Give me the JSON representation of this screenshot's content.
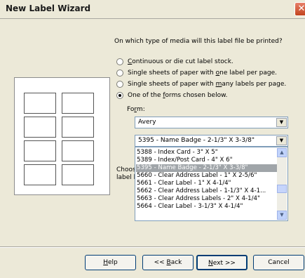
{
  "window": {
    "title": "New Label Wizard"
  },
  "question": "On which type of media will this label file be printed?",
  "options": [
    {
      "pre": "",
      "ul": "C",
      "post": "ontinuous or die cut label stock."
    },
    {
      "pre": "Single sheets of paper with ",
      "ul": "o",
      "post": "ne label per page."
    },
    {
      "pre": "Single sheets of paper with ",
      "ul": "m",
      "post": "any labels per page."
    },
    {
      "pre": "One of the ",
      "ul": "f",
      "post": "orms chosen below."
    }
  ],
  "form": {
    "label_pre": "Fo",
    "label_ul": "r",
    "label_post": "m:",
    "vendor": "Avery",
    "product": "5395 - Name Badge - 2-1/3\" X 3-3/8\""
  },
  "choose": {
    "line1": "Choos",
    "line2": "label l"
  },
  "dropdown": [
    "5388 - Index Card - 3\" X 5\"",
    "5389 - Index/Post Card - 4\" X 6\"",
    "5395 - Name Badge - 2-1/3\" X 3-3/8\"",
    "5660 - Clear Address Label - 1\" X 2-5/6\"",
    "5661 - Clear Label - 1\" X 4-1/4\"",
    "5662 - Clear Address Label - 1-1/3\" X 4-1...",
    "5663 - Clear Address Labels - 2\" X 4-1/4\"",
    "5664 - Clear Label - 3-1/3\" X 4-1/4\""
  ],
  "buttons": {
    "help": {
      "ul": "H",
      "rest": "elp"
    },
    "back": {
      "pre": "<< ",
      "ul": "B",
      "rest": "ack"
    },
    "next": {
      "ul": "N",
      "rest": "ext >>"
    },
    "cancel": "Cancel"
  },
  "colors": {
    "dialog_bg": "#ece9d8",
    "close_button": "#c2441d",
    "selection": "#a0a5a9"
  }
}
